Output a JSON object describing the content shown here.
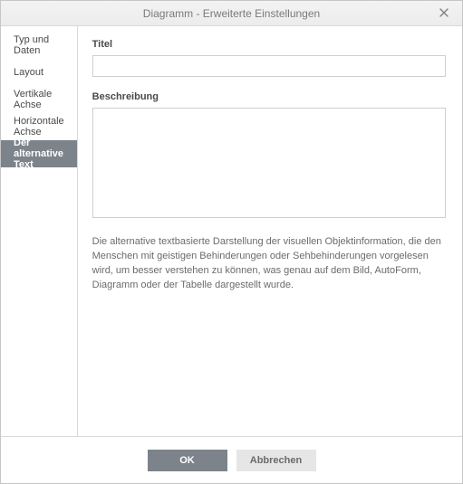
{
  "dialog": {
    "title": "Diagramm - Erweiterte Einstellungen"
  },
  "sidebar": {
    "items": [
      {
        "label": "Typ und Daten",
        "selected": false
      },
      {
        "label": "Layout",
        "selected": false
      },
      {
        "label": "Vertikale Achse",
        "selected": false
      },
      {
        "label": "Horizontale Achse",
        "selected": false
      },
      {
        "label": "Der alternative Text",
        "selected": true
      }
    ]
  },
  "content": {
    "title_label": "Titel",
    "title_value": "",
    "description_label": "Beschreibung",
    "description_value": "",
    "help_text": "Die alternative textbasierte Darstellung der visuellen Objektinformation, die den Menschen mit geistigen Behinderungen oder Sehbehinderungen vorgelesen wird, um besser verstehen zu können, was genau auf dem Bild, AutoForm, Diagramm oder der Tabelle dargestellt wurde."
  },
  "footer": {
    "ok_label": "OK",
    "cancel_label": "Abbrechen"
  }
}
